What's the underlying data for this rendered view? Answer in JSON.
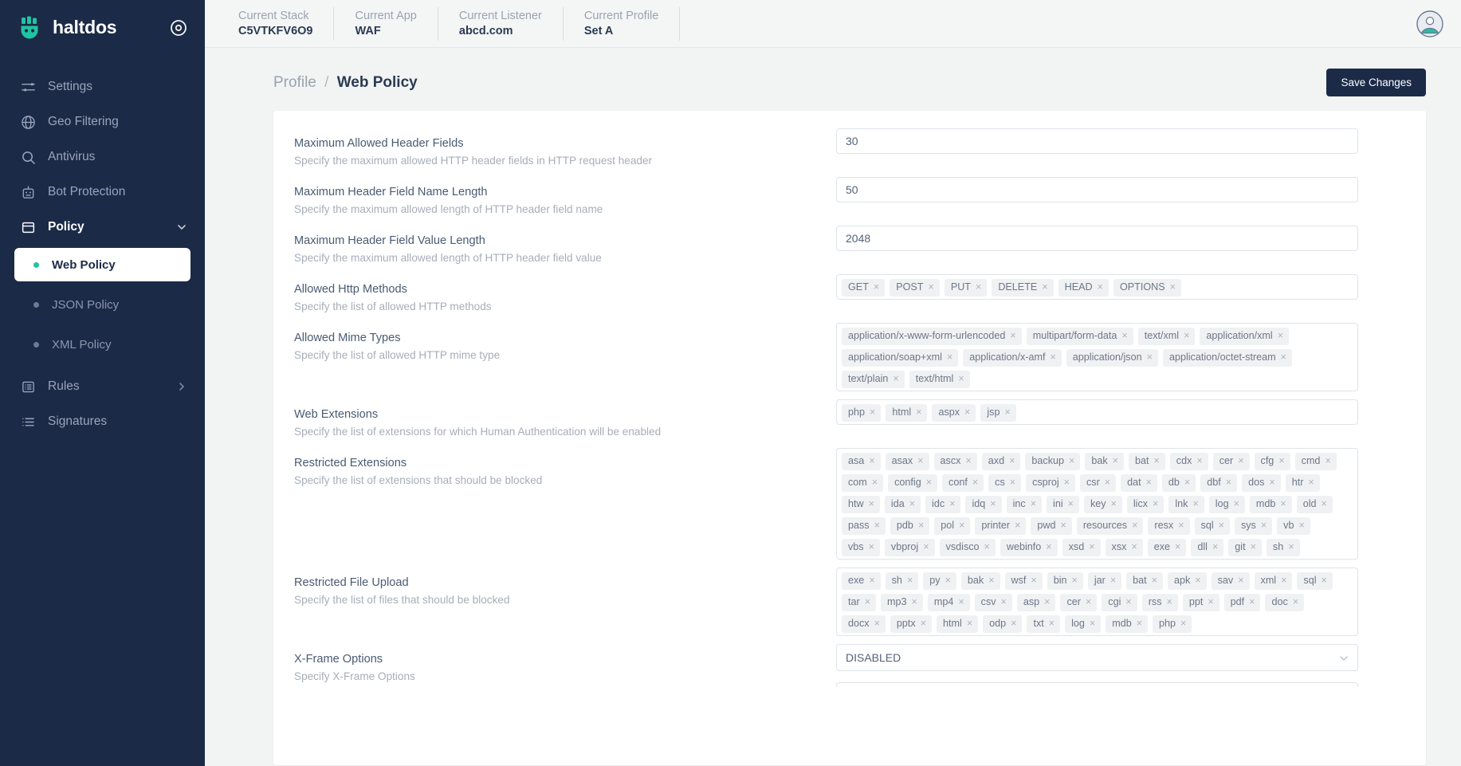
{
  "brand": {
    "name": "haltdos",
    "logo_icon": "shield-logo-icon",
    "target_icon": "target-icon"
  },
  "sidebar": {
    "items": [
      {
        "label": "Settings",
        "icon": "sliders-icon",
        "type": "item"
      },
      {
        "label": "Geo Filtering",
        "icon": "globe-icon",
        "type": "item"
      },
      {
        "label": "Antivirus",
        "icon": "search-icon",
        "type": "item"
      },
      {
        "label": "Bot Protection",
        "icon": "robot-icon",
        "type": "item"
      },
      {
        "label": "Policy",
        "icon": "window-icon",
        "type": "parent",
        "expanded": true,
        "chevron": "chevron-down-icon"
      },
      {
        "label": "Web Policy",
        "type": "sub",
        "selected": true
      },
      {
        "label": "JSON Policy",
        "type": "sub",
        "selected": false
      },
      {
        "label": "XML Policy",
        "type": "sub",
        "selected": false
      },
      {
        "label": "Rules",
        "icon": "list-box-icon",
        "type": "parent",
        "expanded": false,
        "chevron": "chevron-right-icon"
      },
      {
        "label": "Signatures",
        "icon": "list-icon",
        "type": "item"
      }
    ]
  },
  "topbar": {
    "contexts": [
      {
        "label": "Current Stack",
        "value": "C5VTKFV6O9"
      },
      {
        "label": "Current App",
        "value": "WAF"
      },
      {
        "label": "Current Listener",
        "value": "abcd.com"
      },
      {
        "label": "Current Profile",
        "value": "Set A"
      }
    ],
    "avatar_icon": "user-avatar-icon"
  },
  "page": {
    "breadcrumb_parent": "Profile",
    "breadcrumb_sep": "/",
    "breadcrumb_current": "Web Policy",
    "save_label": "Save Changes"
  },
  "fields": {
    "max_header_fields": {
      "label": "Maximum Allowed Header Fields",
      "desc": "Specify the maximum allowed HTTP header fields in HTTP request header",
      "value": "30"
    },
    "max_header_name_len": {
      "label": "Maximum Header Field Name Length",
      "desc": "Specify the maximum allowed length of HTTP header field name",
      "value": "50"
    },
    "max_header_value_len": {
      "label": "Maximum Header Field Value Length",
      "desc": "Specify the maximum allowed length of HTTP header field value",
      "value": "2048"
    },
    "allowed_http_methods": {
      "label": "Allowed Http Methods",
      "desc": "Specify the list of allowed HTTP methods",
      "tags": [
        "GET",
        "POST",
        "PUT",
        "DELETE",
        "HEAD",
        "OPTIONS"
      ]
    },
    "allowed_mime_types": {
      "label": "Allowed Mime Types",
      "desc": "Specify the list of allowed HTTP mime type",
      "tags": [
        "application/x-www-form-urlencoded",
        "multipart/form-data",
        "text/xml",
        "application/xml",
        "application/soap+xml",
        "application/x-amf",
        "application/json",
        "application/octet-stream",
        "text/plain",
        "text/html"
      ]
    },
    "web_extensions": {
      "label": "Web Extensions",
      "desc": "Specify the list of extensions for which Human Authentication will be enabled",
      "tags": [
        "php",
        "html",
        "aspx",
        "jsp"
      ]
    },
    "restricted_extensions": {
      "label": "Restricted Extensions",
      "desc": "Specify the list of extensions that should be blocked",
      "tags": [
        "asa",
        "asax",
        "ascx",
        "axd",
        "backup",
        "bak",
        "bat",
        "cdx",
        "cer",
        "cfg",
        "cmd",
        "com",
        "config",
        "conf",
        "cs",
        "csproj",
        "csr",
        "dat",
        "db",
        "dbf",
        "dos",
        "htr",
        "htw",
        "ida",
        "idc",
        "idq",
        "inc",
        "ini",
        "key",
        "licx",
        "lnk",
        "log",
        "mdb",
        "old",
        "pass",
        "pdb",
        "pol",
        "printer",
        "pwd",
        "resources",
        "resx",
        "sql",
        "sys",
        "vb",
        "vbs",
        "vbproj",
        "vsdisco",
        "webinfo",
        "xsd",
        "xsx",
        "exe",
        "dll",
        "git",
        "sh"
      ]
    },
    "restricted_file_upload": {
      "label": "Restricted File Upload",
      "desc": "Specify the list of files that should be blocked",
      "tags": [
        "exe",
        "sh",
        "py",
        "bak",
        "wsf",
        "bin",
        "jar",
        "bat",
        "apk",
        "sav",
        "xml",
        "sql",
        "tar",
        "mp3",
        "mp4",
        "csv",
        "asp",
        "cer",
        "cgi",
        "rss",
        "ppt",
        "pdf",
        "doc",
        "docx",
        "pptx",
        "html",
        "odp",
        "txt",
        "log",
        "mdb",
        "php"
      ]
    },
    "x_frame_options": {
      "label": "X-Frame Options",
      "desc": "Specify X-Frame Options",
      "value": "DISABLED",
      "caret_icon": "chevron-down-icon"
    }
  },
  "colors": {
    "sidebar_bg": "#1b2a47",
    "accent_teal": "#20c3a2",
    "page_bg": "#f2f4f4",
    "text_dark": "#2b3a52",
    "text_muted": "#a7aeb8"
  }
}
